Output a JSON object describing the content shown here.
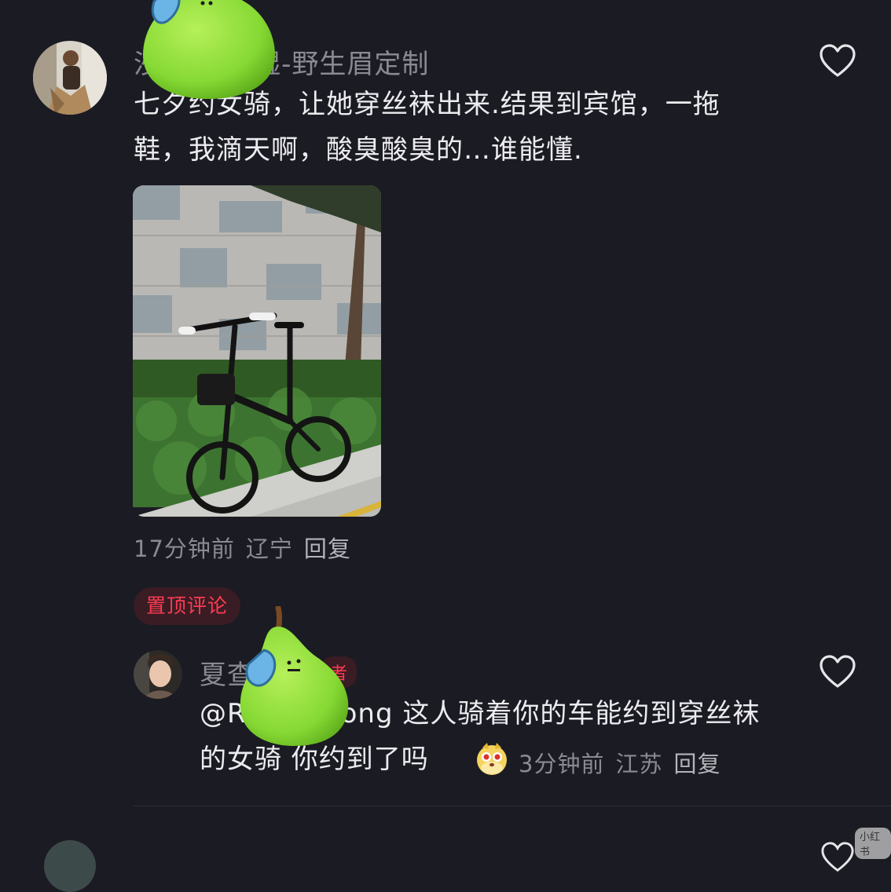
{
  "comment1": {
    "username": "沙          湿-野生眉定制",
    "text": "七夕约女骑，让她穿丝袜出来.结果到宾馆，一拖鞋，我滴天啊，酸臭酸臭的…谁能懂.",
    "time": "17分钟前",
    "location": "辽宁",
    "reply_label": "回复"
  },
  "pinned_label": "置顶评论",
  "comment2": {
    "username": "夏查",
    "author_badge": "者",
    "mention_prefix": "@R",
    "mention_suffix": "ong",
    "text_after_mention": " 这人骑着你的车能约到穿丝袜的女骑 你约到了吗",
    "time": "3分钟前",
    "location": "江苏",
    "reply_label": "回复"
  },
  "watermark": "小红书",
  "icons": {
    "like": "heart-outline-icon",
    "sticker": "pear-sweat-sticker",
    "emoji": "peeking-face-emoji"
  },
  "colors": {
    "background": "#1b1b23",
    "pin_red": "#ff3b52",
    "meta_gray": "#8a8a93",
    "pear_green": "#8fe13a"
  }
}
